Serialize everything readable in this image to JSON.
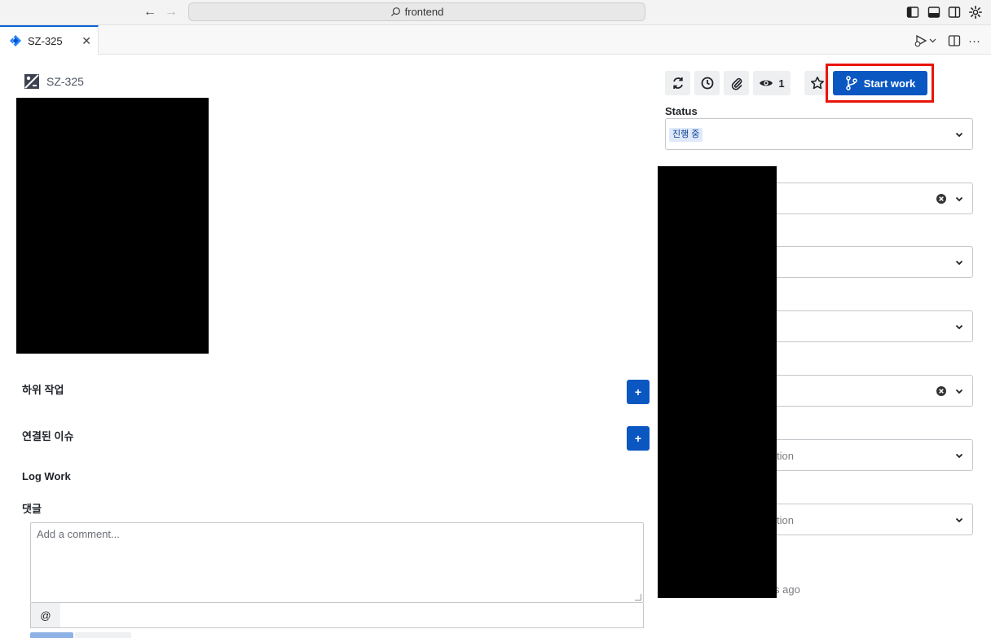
{
  "titlebar": {
    "back_icon": "arrow-left-icon",
    "forward_icon": "arrow-right-icon",
    "search_text": "frontend",
    "layout_icons": [
      "sidebar-left-icon",
      "panel-bottom-icon",
      "sidebar-right-icon",
      "settings-gear-icon"
    ]
  },
  "tab": {
    "label": "SZ-325",
    "close_glyph": "✕",
    "icon": "jira-icon"
  },
  "tab_actions": {
    "run_icon": "run-debug-icon",
    "split_icon": "split-editor-icon",
    "more_glyph": "···"
  },
  "issue": {
    "key": "SZ-325",
    "type_icon": "issue-type-icon"
  },
  "sections": {
    "subtasks": "하위 작업",
    "linked_issues": "연결된 이슈",
    "log_work": "Log Work",
    "comments": "댓글",
    "add_glyph": "+"
  },
  "comment": {
    "placeholder": "Add a comment...",
    "mention": "@"
  },
  "toolbar": {
    "watch_count": "1",
    "start_work_label": "Start work"
  },
  "status": {
    "label": "Status",
    "value": "진행 중"
  },
  "fields": {
    "partial_1": "tion",
    "partial_2": "tion",
    "updated_suffix": "s ago"
  },
  "colors": {
    "primary": "#0b57c2",
    "highlight": "#e8150b",
    "lozenge_bg": "#dfe9fb"
  }
}
